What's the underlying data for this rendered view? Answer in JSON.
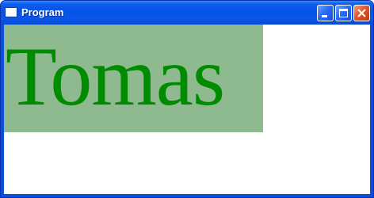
{
  "window": {
    "title": "Program",
    "app_icon": "window-icon",
    "controls": {
      "minimize_icon": "minimize-icon",
      "maximize_icon": "maximize-icon",
      "close_icon": "close-icon"
    }
  },
  "content": {
    "name_label": "Tomas",
    "text_color": "#008c00",
    "panel_color": "#8fb98f"
  }
}
